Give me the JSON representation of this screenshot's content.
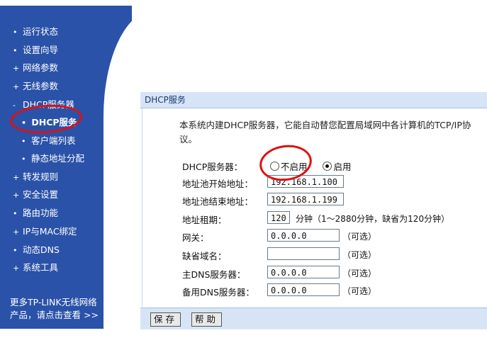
{
  "sidebar": {
    "items": [
      {
        "bullet": "•",
        "label": "运行状态"
      },
      {
        "bullet": "•",
        "label": "设置向导"
      },
      {
        "bullet": "+",
        "label": "网络参数"
      },
      {
        "bullet": "+",
        "label": "无线参数"
      },
      {
        "bullet": "-",
        "label": "DHCP服务器"
      },
      {
        "bullet": "•",
        "label": "DHCP服务"
      },
      {
        "bullet": "•",
        "label": "客户端列表"
      },
      {
        "bullet": "•",
        "label": "静态地址分配"
      },
      {
        "bullet": "+",
        "label": "转发规则"
      },
      {
        "bullet": "+",
        "label": "安全设置"
      },
      {
        "bullet": "•",
        "label": "路由功能"
      },
      {
        "bullet": "+",
        "label": "IP与MAC绑定"
      },
      {
        "bullet": "•",
        "label": "动态DNS"
      },
      {
        "bullet": "+",
        "label": "系统工具"
      }
    ],
    "footer_line1": "更多TP-LINK无线网络",
    "footer_line2": "产品，请点击查看 >>"
  },
  "panel": {
    "title": "DHCP服务",
    "description": "本系统内建DHCP服务器，它能自动替您配置局域网中各计算机的TCP/IP协议。",
    "fields": {
      "dhcp_server_label": "DHCP服务器：",
      "disable_label": "不启用",
      "enable_label": "启用",
      "selected": "enable",
      "pool_start_label": "地址池开始地址：",
      "pool_start_value": "192.168.1.100",
      "pool_end_label": "地址池结束地址：",
      "pool_end_value": "192.168.1.199",
      "lease_label": "地址租期：",
      "lease_value": "120",
      "lease_hint": "分钟（1～2880分钟，缺省为120分钟）",
      "gateway_label": "网关：",
      "gateway_value": "0.0.0.0",
      "domain_label": "缺省域名：",
      "domain_value": "",
      "primary_dns_label": "主DNS服务器：",
      "primary_dns_value": "0.0.0.0",
      "secondary_dns_label": "备用DNS服务器：",
      "secondary_dns_value": "0.0.0.0",
      "optional_hint": "（可选）"
    },
    "buttons": {
      "save": "保存",
      "help": "帮助"
    }
  },
  "colors": {
    "sidebar": "#2a52a8",
    "panel_header": "#d6e4f6",
    "annotation": "#e01010"
  }
}
